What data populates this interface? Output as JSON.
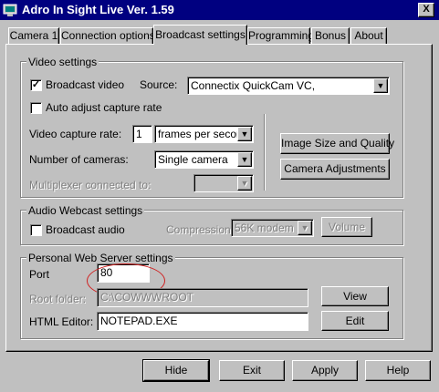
{
  "window": {
    "title": "Adro In Sight Live   Ver. 1.59",
    "close_glyph": "X"
  },
  "tabs": [
    {
      "label": "Camera 1"
    },
    {
      "label": "Connection options"
    },
    {
      "label": "Broadcast settings",
      "active": true
    },
    {
      "label": "Programming"
    },
    {
      "label": "Bonus"
    },
    {
      "label": "About"
    }
  ],
  "video_settings": {
    "title": "Video settings",
    "broadcast_video": {
      "label": "Broadcast video",
      "checked": true,
      "mark": "✓"
    },
    "source": {
      "label": "Source:",
      "value": "Connectix QuickCam VC,"
    },
    "auto_adjust": {
      "label": "Auto adjust capture rate",
      "checked": false
    },
    "capture_rate": {
      "label": "Video capture rate:",
      "value": "1",
      "unit": "frames per second"
    },
    "num_cameras": {
      "label": "Number of cameras:",
      "value": "Single camera"
    },
    "multiplexer": {
      "label": "Multiplexer connected to:",
      "value": ""
    },
    "image_size_button": "Image Size and Quality",
    "camera_adjust_button": "Camera Adjustments"
  },
  "audio_settings": {
    "title": "Audio Webcast settings",
    "broadcast_audio": {
      "label": "Broadcast audio",
      "checked": false
    },
    "compression": {
      "label": "Compression:",
      "value": "56K modem"
    },
    "volume_button": "Volume"
  },
  "web_server": {
    "title": "Personal Web Server settings",
    "port": {
      "label": "Port",
      "value": "80"
    },
    "root_folder": {
      "label": "Root folder:",
      "value": "C:\\COWWWROOT"
    },
    "view_button": "View",
    "html_editor": {
      "label": "HTML Editor:",
      "value": "NOTEPAD.EXE"
    },
    "edit_button": "Edit"
  },
  "footer": {
    "hide": "Hide",
    "exit": "Exit",
    "apply": "Apply",
    "help": "Help"
  },
  "colors": {
    "titlebar": "#000080",
    "face": "#c0c0c0",
    "highlight_ring": "#d02020"
  }
}
